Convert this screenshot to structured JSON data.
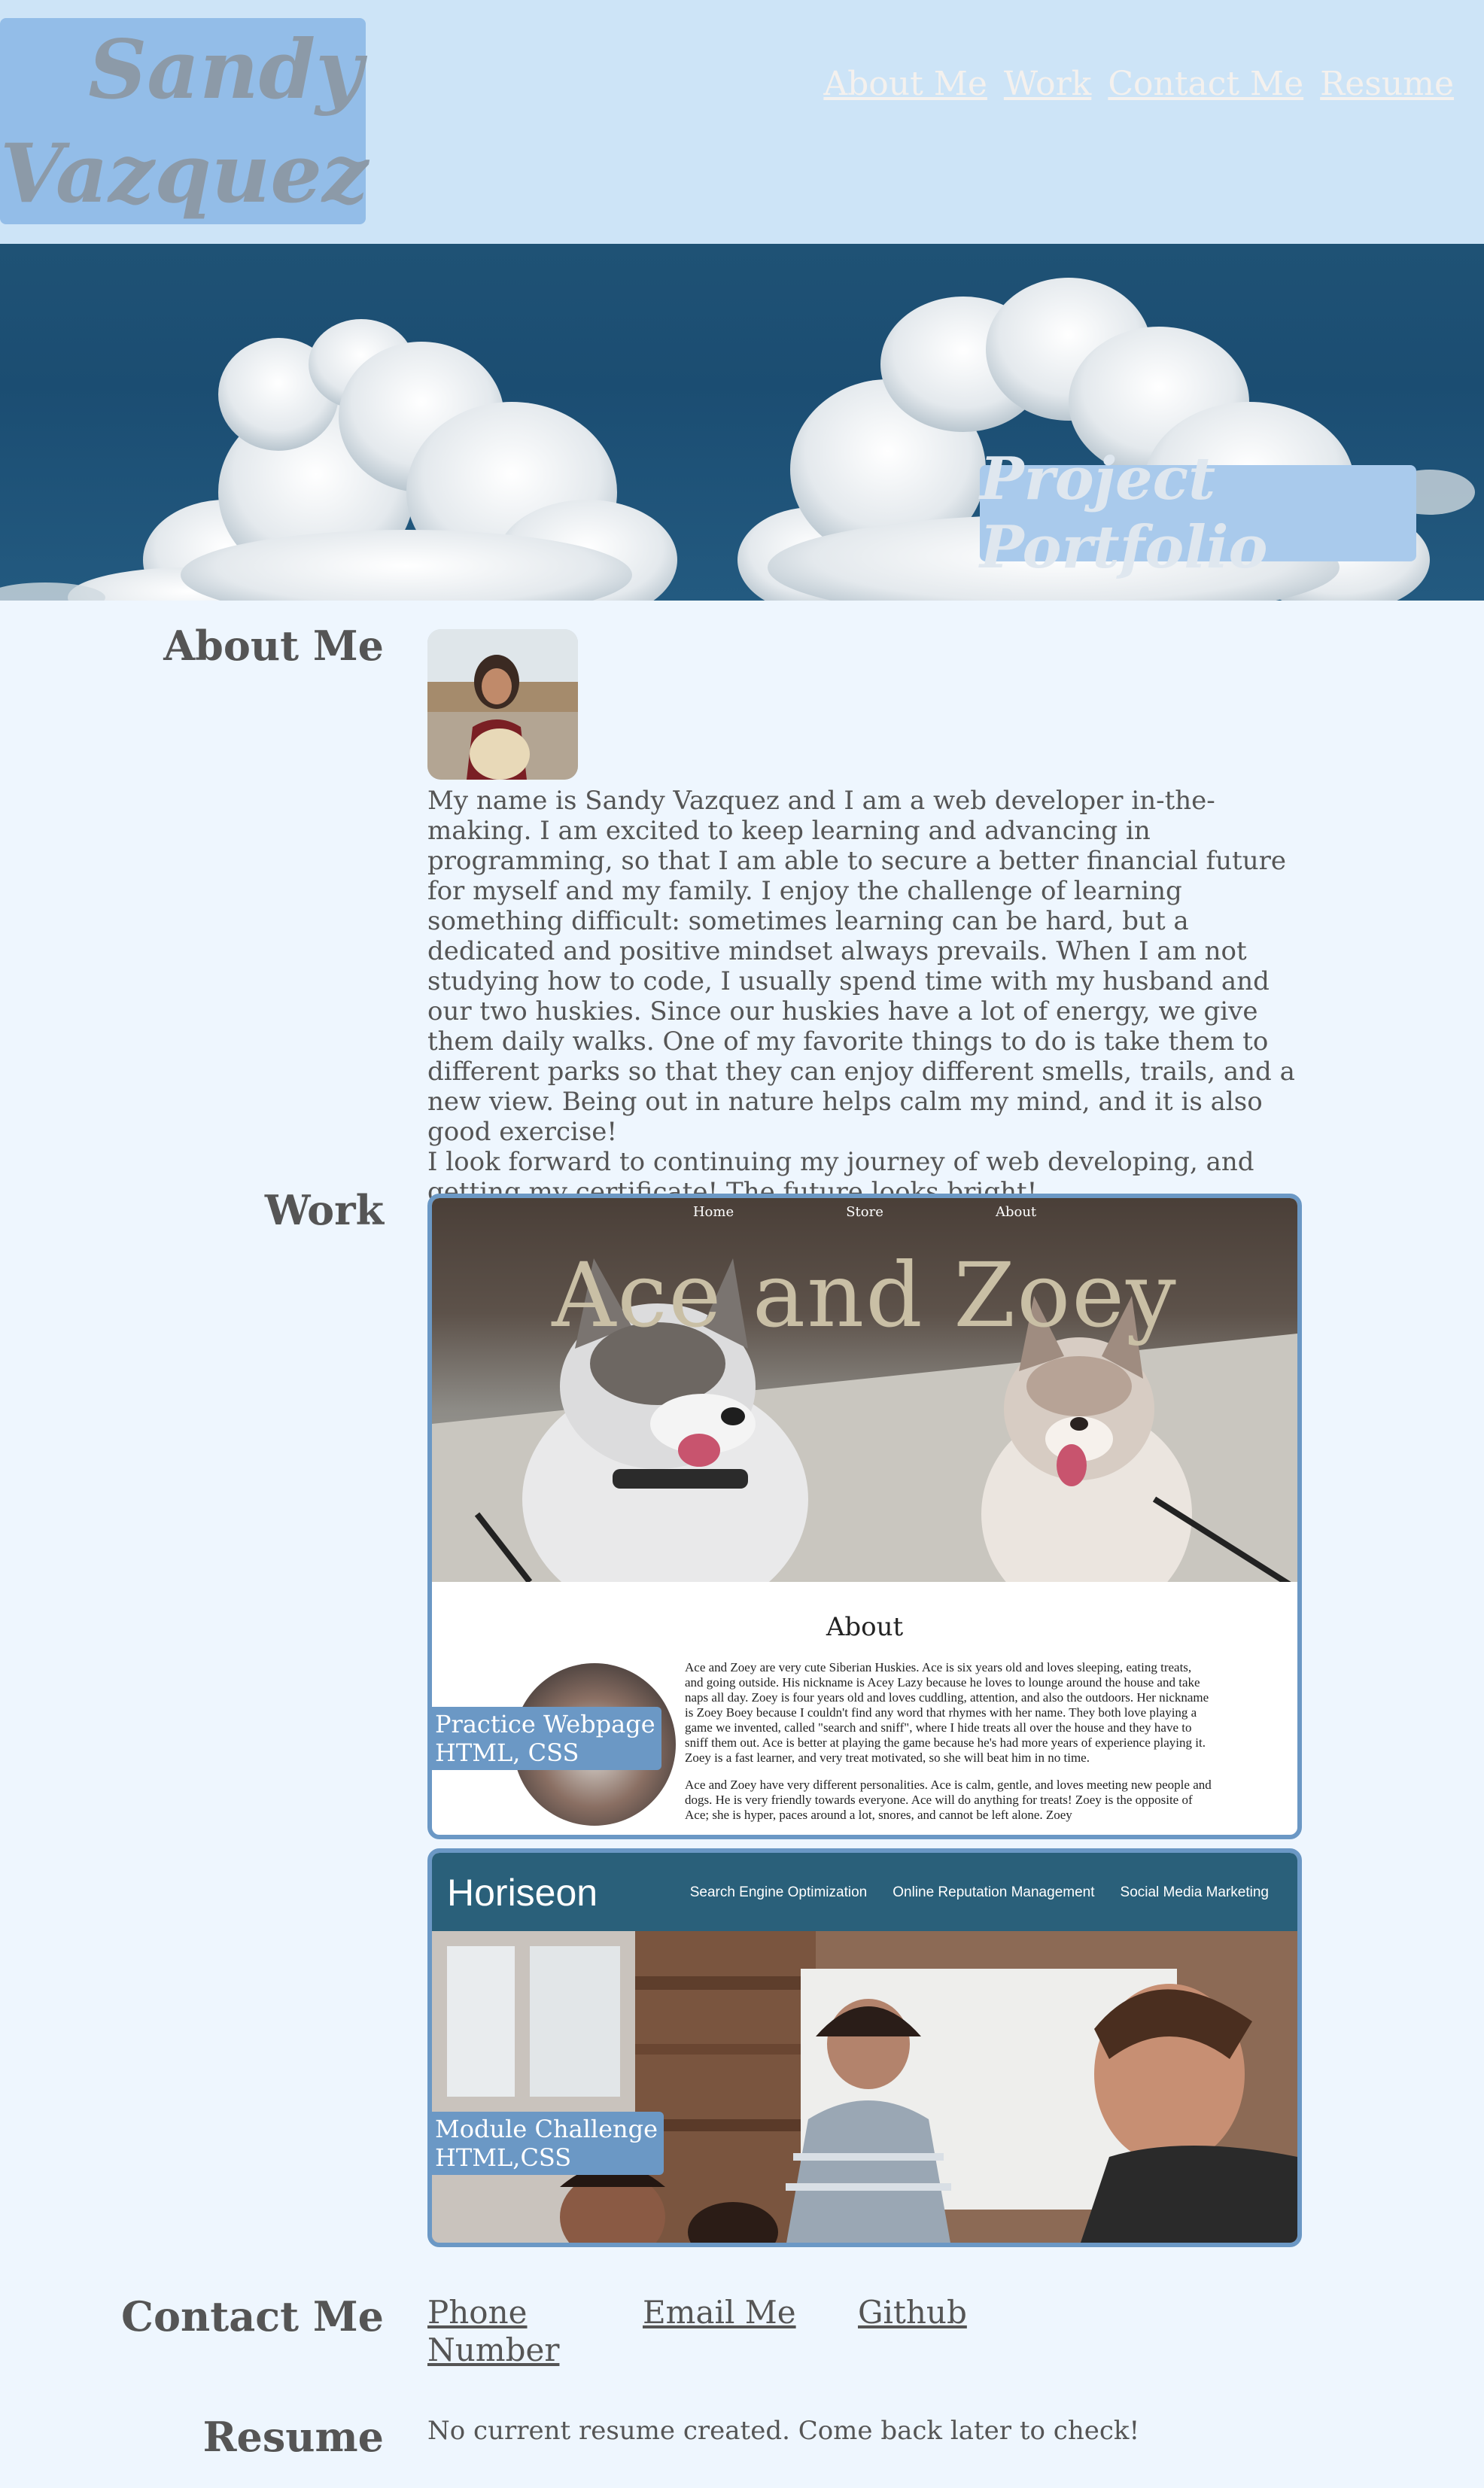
{
  "header": {
    "name_line1": "Sandy",
    "name_line2": "Vazquez",
    "nav": [
      "About Me",
      "Work",
      "Contact Me",
      "Resume"
    ]
  },
  "hero": {
    "title": "Project Portfolio"
  },
  "about": {
    "heading": "About Me",
    "paragraph1": "My name is Sandy Vazquez and I am a web developer in-the-making. I am excited to keep learning and advancing in programming, so that I am able to secure a better financial future for myself and my family. I enjoy the challenge of learning something difficult: sometimes learning can be hard, but a dedicated and positive mindset always prevails. When I am not studying how to code, I usually spend time with my husband and our two huskies. Since our huskies have a lot of energy, we give them daily walks. One of my favorite things to do is take them to different parks so that they can enjoy different smells, trails, and a new view. Being out in nature helps calm my mind, and it is also good exercise!",
    "paragraph2": "I look forward to continuing my journey of web developing, and getting my certificate! The future looks bright!"
  },
  "work": {
    "heading": "Work",
    "projects": [
      {
        "label_line1": "Practice Webpage",
        "label_line2": "HTML, CSS",
        "preview": {
          "nav": [
            "Home",
            "Store",
            "About"
          ],
          "title": "Ace and Zoey",
          "about_heading": "About",
          "about_p1": "Ace and Zoey are very cute Siberian Huskies. Ace is six years old and loves sleeping, eating treats, and going outside. His nickname is Acey Lazy because he loves to lounge around the house and take naps all day. Zoey is four years old and loves cuddling, attention, and also the outdoors. Her nickname is Zoey Boey because I couldn't find any word that rhymes with her name. They both love playing a game we invented, called \"search and sniff\", where I hide treats all over the house and they have to sniff them out. Ace is better at playing the game because he's had more years of experience playing it. Zoey is a fast learner, and very treat motivated, so she will beat him in no time.",
          "about_p2": "Ace and Zoey have very different personalities. Ace is calm, gentle, and loves meeting new people and dogs. He is very friendly towards everyone. Ace will do anything for treats! Zoey is the opposite of Ace; she is hyper, paces around a lot, snores, and cannot be left alone. Zoey"
        }
      },
      {
        "label_line1": "Module Challenge",
        "label_line2": "HTML,CSS",
        "preview": {
          "logo": "Horiseon",
          "nav": [
            "Search Engine Optimization",
            "Online Reputation Management",
            "Social Media Marketing"
          ]
        }
      }
    ]
  },
  "contact": {
    "heading": "Contact Me",
    "links": [
      "Phone\nNumber",
      "Email Me",
      "Github"
    ]
  },
  "resume": {
    "heading": "Resume",
    "text": "No current resume created. Come back later to check!"
  }
}
